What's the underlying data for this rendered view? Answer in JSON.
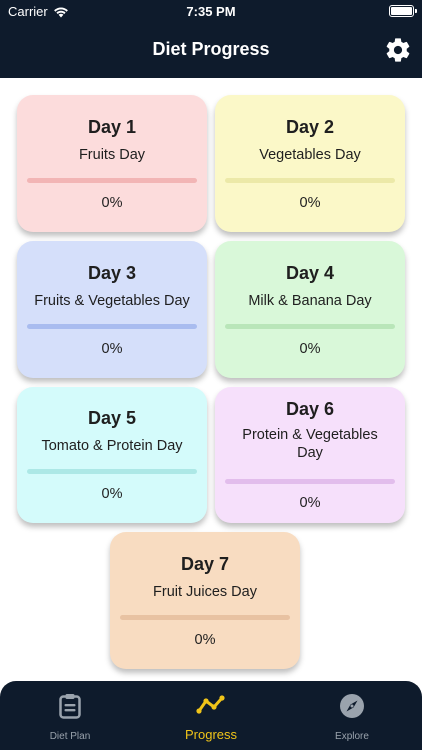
{
  "status_bar": {
    "carrier": "Carrier",
    "time": "7:35 PM"
  },
  "nav": {
    "title": "Diet Progress",
    "settings_icon": "gear-icon"
  },
  "cards": [
    {
      "day": "Day 1",
      "name": "Fruits Day",
      "progress": "0%",
      "bg": "#fcdcdc",
      "bar": "#f2b5b5"
    },
    {
      "day": "Day 2",
      "name": "Vegetables Day",
      "progress": "0%",
      "bg": "#fbf8c8",
      "bar": "#ece9a8"
    },
    {
      "day": "Day 3",
      "name": "Fruits & Vegetables Day",
      "progress": "0%",
      "bg": "#d5dffa",
      "bar": "#a9bcef"
    },
    {
      "day": "Day 4",
      "name": "Milk & Banana Day",
      "progress": "0%",
      "bg": "#d9f8d9",
      "bar": "#b9e6b9"
    },
    {
      "day": "Day 5",
      "name": "Tomato & Protein Day",
      "progress": "0%",
      "bg": "#d4fbfb",
      "bar": "#ace8e6"
    },
    {
      "day": "Day 6",
      "name": "Protein & Vegetables Day",
      "progress": "0%",
      "bg": "#f6e0fb",
      "bar": "#e2bdec"
    },
    {
      "day": "Day 7",
      "name": "Fruit Juices Day",
      "progress": "0%",
      "bg": "#f8dcc1",
      "bar": "#e8c2a2"
    }
  ],
  "tabs": [
    {
      "label": "Diet Plan",
      "icon": "clipboard-icon",
      "active": false
    },
    {
      "label": "Progress",
      "icon": "trend-line-icon",
      "active": true
    },
    {
      "label": "Explore",
      "icon": "compass-icon",
      "active": false
    }
  ],
  "colors": {
    "header_bg": "#0e1b2c",
    "active_tab": "#f0c419",
    "inactive_tab": "#9aa3ad"
  }
}
